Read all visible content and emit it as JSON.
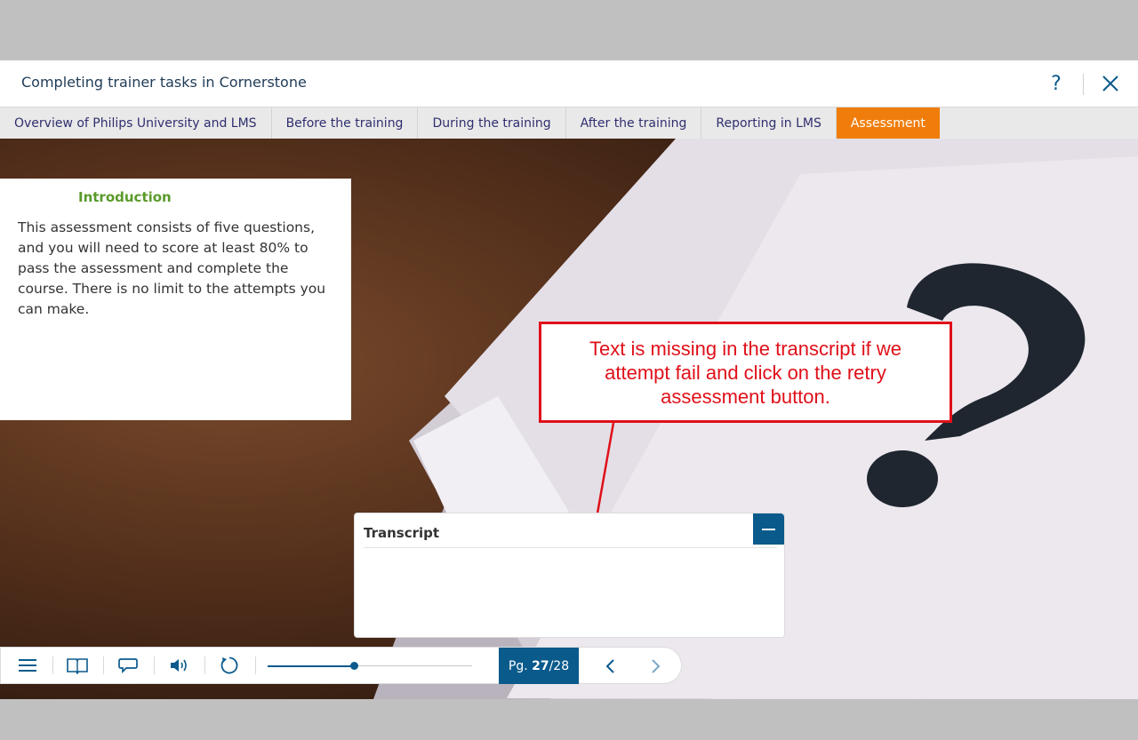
{
  "header": {
    "course_title": "Completing trainer tasks in Cornerstone",
    "help_label": "?"
  },
  "nav": {
    "tabs": [
      {
        "label": "Overview of Philips University and LMS",
        "active": false
      },
      {
        "label": "Before the training",
        "active": false
      },
      {
        "label": "During the training",
        "active": false
      },
      {
        "label": "After the training",
        "active": false
      },
      {
        "label": "Reporting in LMS",
        "active": false
      },
      {
        "label": "Assessment",
        "active": true
      }
    ]
  },
  "intro": {
    "heading": "Introduction",
    "body": "This assessment consists of five questions, and you will need to score at least 80% to pass the assessment and complete the course. There is no limit to the attempts you can make."
  },
  "annotation": {
    "text": "Text is missing in the transcript if we attempt fail and click on the retry assessment button."
  },
  "transcript": {
    "title": "Transcript"
  },
  "player": {
    "page_prefix": "Pg. ",
    "page_current": "27",
    "page_total": "/28",
    "progress_fraction": 0.42
  },
  "colors": {
    "accent": "#0a5a8c",
    "active_tab": "#f07d0b",
    "heading_green": "#5a9a2a",
    "annotation_red": "#e0101a"
  },
  "icons": [
    "help-icon",
    "close-icon",
    "menu-icon",
    "book-icon",
    "chat-icon",
    "volume-icon",
    "replay-icon",
    "chevron-left-icon",
    "chevron-right-icon",
    "minus-icon"
  ]
}
